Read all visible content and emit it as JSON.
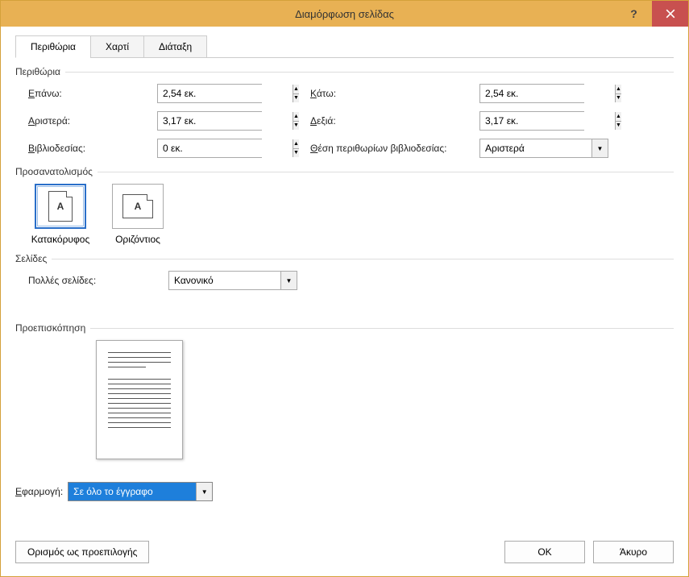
{
  "title": "Διαμόρφωση σελίδας",
  "tabs": {
    "margins": "Περιθώρια",
    "paper": "Χαρτί",
    "layout": "Διάταξη"
  },
  "groups": {
    "margins": "Περιθώρια",
    "orientation": "Προσανατολισμός",
    "pages": "Σελίδες",
    "preview": "Προεπισκόπηση"
  },
  "labels": {
    "top": "Επάνω:",
    "bottom": "Κάτω:",
    "left": "Αριστερά:",
    "right": "Δεξιά:",
    "gutter": "Βιβλιοδεσίας:",
    "gutterPos": "Θέση περιθωρίων βιβλιοδεσίας:",
    "multiPages": "Πολλές σελίδες:",
    "applyTo": "Εφαρμογή:"
  },
  "values": {
    "top": "2,54 εκ.",
    "bottom": "2,54 εκ.",
    "left": "3,17 εκ.",
    "right": "3,17 εκ.",
    "gutter": "0 εκ.",
    "gutterPos": "Αριστερά",
    "multiPages": "Κανονικό",
    "applyTo": "Σε όλο το έγγραφο"
  },
  "orientation": {
    "portraitGlyph": "A",
    "landscapeGlyph": "A",
    "portrait": "Κατακόρυφος",
    "landscape": "Οριζόντιος"
  },
  "buttons": {
    "setDefault": "Ορισμός ως προεπιλογής",
    "ok": "OK",
    "cancel": "Άκυρο"
  }
}
